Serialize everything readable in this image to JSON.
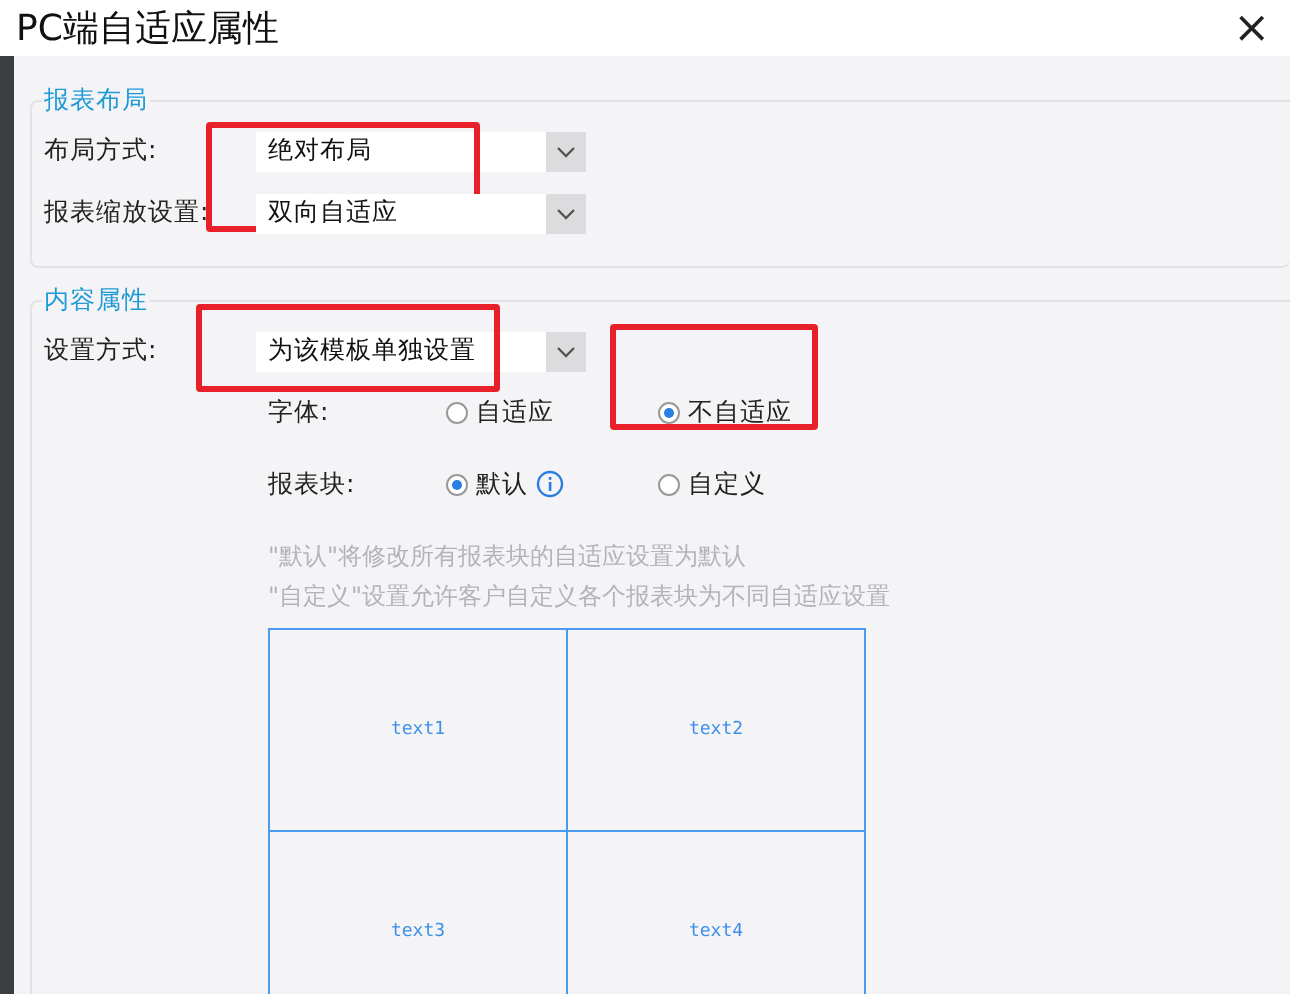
{
  "window": {
    "title": "PC端自适应属性",
    "close": "×"
  },
  "layout_section": {
    "legend": "报表布局",
    "highlighted": true,
    "fields": [
      {
        "label": "布局方式:",
        "value": "绝对布局"
      },
      {
        "label": "报表缩放设置:",
        "value": "双向自适应"
      }
    ]
  },
  "content_section": {
    "legend": "内容属性",
    "setting": {
      "label": "设置方式:",
      "value": "为该模板单独设置",
      "highlighted": true
    },
    "radio_rows": [
      {
        "label": "字体:",
        "options": [
          {
            "label": "自适应",
            "selected": false,
            "highlighted": false,
            "info": false
          },
          {
            "label": "不自适应",
            "selected": true,
            "highlighted": true,
            "info": false
          }
        ]
      },
      {
        "label": "报表块:",
        "options": [
          {
            "label": "默认",
            "selected": true,
            "highlighted": false,
            "info": true
          },
          {
            "label": "自定义",
            "selected": false,
            "highlighted": false,
            "info": false
          }
        ]
      }
    ],
    "hints": [
      "\"默认\"将修改所有报表块的自适应设置为默认",
      "\"自定义\"设置允许客户自定义各个报表块为不同自适应设置"
    ],
    "blocks": [
      "text1",
      "text2",
      "text3",
      "text4"
    ]
  }
}
